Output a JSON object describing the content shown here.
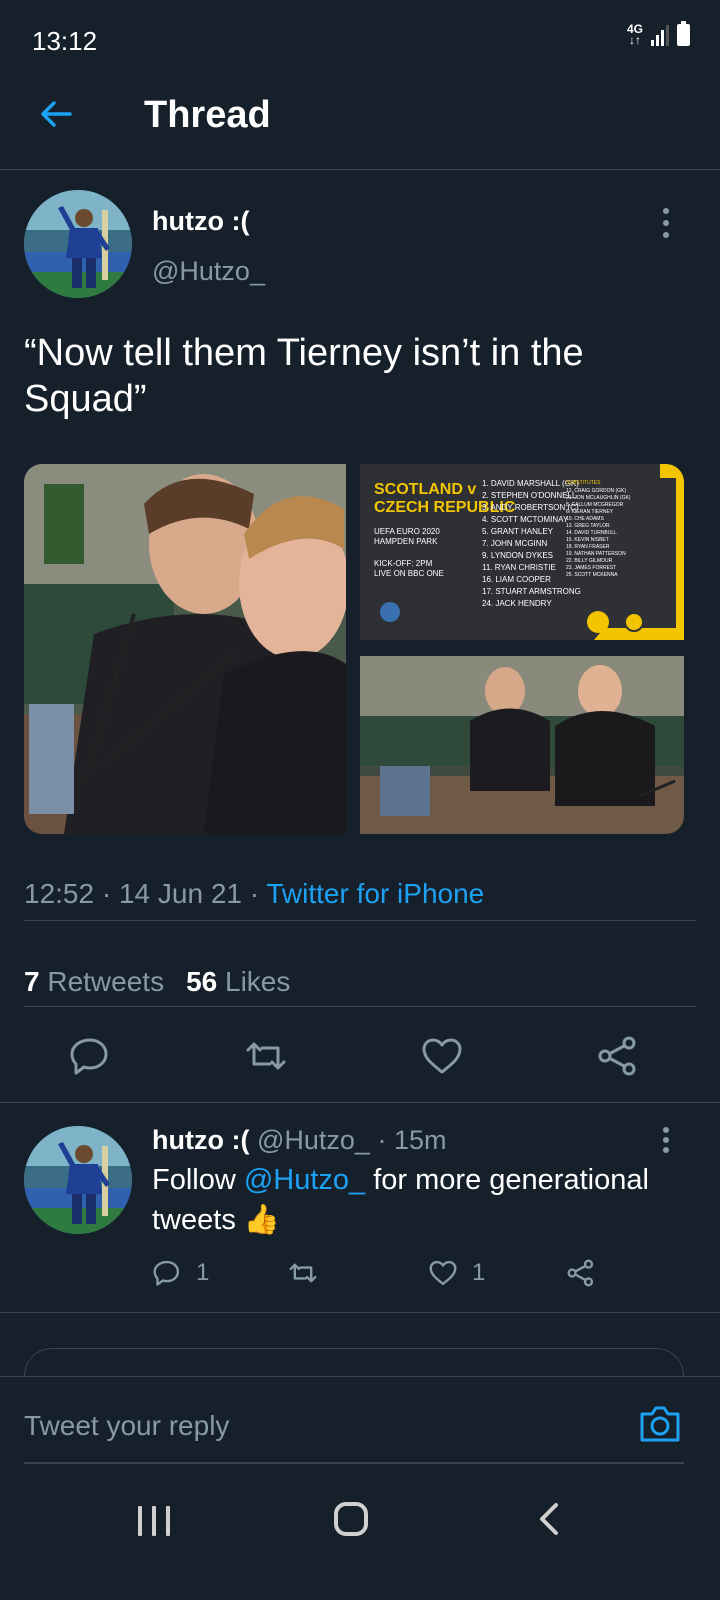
{
  "status_bar": {
    "time": "13:12",
    "network": "4G",
    "battery_level": 1.0,
    "signal_bars": 3
  },
  "header": {
    "title": "Thread",
    "back_icon": "arrow-left-icon"
  },
  "tweet": {
    "author_name": "hutzo :(",
    "handle": "@Hutzo_",
    "text": "“Now tell them Tierney isn’t in the Squad”",
    "media_graphic": {
      "heading": "SCOTLAND v\nCZECH REPUBLIC",
      "event": "UEFA EURO 2020\nHAMPDEN PARK",
      "kickoff": "KICK-OFF: 2PM\nLIVE ON BBC ONE",
      "starting": [
        "1. DAVID MARSHALL (GK)",
        "2. STEPHEN O'DONNELL",
        "3. ANDY ROBERTSON (C)",
        "4. SCOTT MCTOMINAY",
        "5. GRANT HANLEY",
        "7. JOHN MCGINN",
        "9. LYNDON DYKES",
        "11. RYAN CHRISTIE",
        "16. LIAM COOPER",
        "17. STUART ARMSTRONG",
        "24. JACK HENDRY"
      ],
      "subs_heading": "SUBSTITUTES",
      "subs": [
        "12. CRAIG GORDON (GK)",
        "21. JON MCLAUGHLIN (GK)",
        "8. CALLUM MCGREGOR",
        "6. KIERAN TIERNEY",
        "10. CHE ADAMS",
        "13. GREG TAYLOR",
        "14. DAVID TURNBULL",
        "15. KEVIN NISBET",
        "18. RYAN FRASER",
        "19. NATHAN PATTERSON",
        "22. BILLY GILMOUR",
        "23. JAMES FORREST",
        "25. SCOTT MCKENNA"
      ]
    },
    "time": "12:52",
    "date": "14 Jun 21",
    "source": "Twitter for iPhone",
    "separator": " · ",
    "retweets_count": "7",
    "retweets_label": "Retweets",
    "likes_count": "56",
    "likes_label": "Likes",
    "actions": [
      "reply-icon",
      "retweet-icon",
      "like-icon",
      "share-icon"
    ]
  },
  "reply": {
    "author_name": "hutzo :(",
    "handle": "@Hutzo_",
    "time_ago": "· 15m",
    "text_before": "Follow ",
    "mention": "@Hutzo_",
    "text_after": " for more generational tweets 👍",
    "reply_count": "1",
    "like_count": "1"
  },
  "composer": {
    "placeholder": "Tweet your reply",
    "camera_icon": "camera-icon"
  },
  "colors": {
    "background": "#15202b",
    "accent": "#1da1f2",
    "muted": "#8899a6",
    "divider": "#38444d"
  }
}
